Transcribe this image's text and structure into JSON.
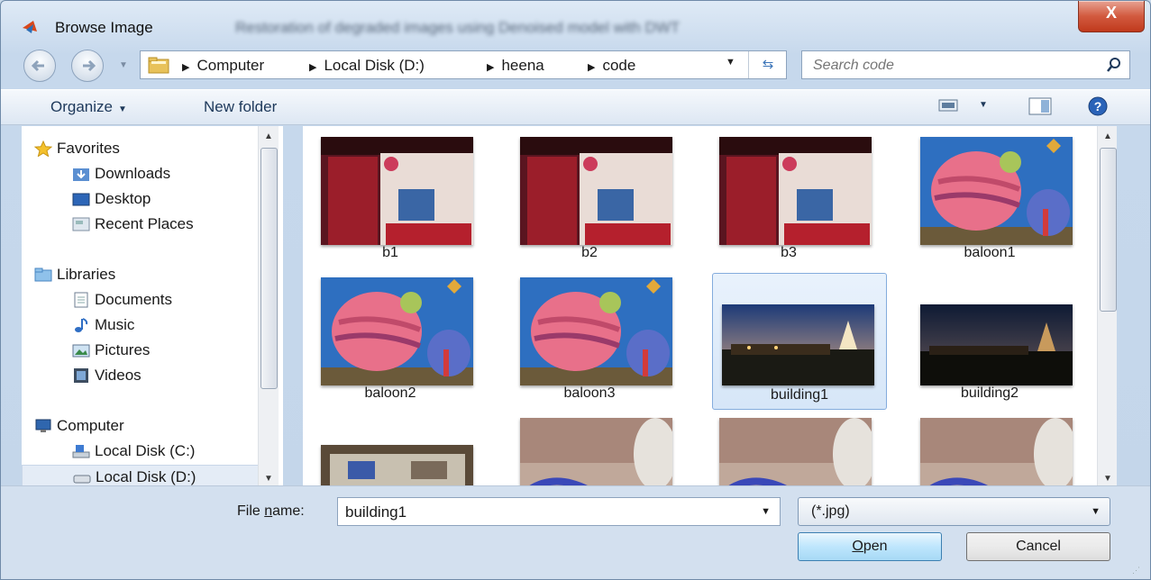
{
  "window": {
    "title": "Browse Image",
    "background_title": "Restoration of degraded images using Denoised model with DWT",
    "close_label": "X"
  },
  "address": {
    "crumbs": [
      "Computer",
      "Local Disk (D:)",
      "heena",
      "code"
    ]
  },
  "search": {
    "placeholder": "Search code"
  },
  "toolbar": {
    "organize_label": "Organize",
    "new_folder_label": "New folder"
  },
  "nav": {
    "favorites_label": "Favorites",
    "downloads_label": "Downloads",
    "desktop_label": "Desktop",
    "recent_label": "Recent Places",
    "libraries_label": "Libraries",
    "documents_label": "Documents",
    "music_label": "Music",
    "pictures_label": "Pictures",
    "videos_label": "Videos",
    "computer_label": "Computer",
    "disk_c_label": "Local Disk (C:)",
    "disk_d_label": "Local Disk (D:)"
  },
  "files": [
    "b1",
    "b2",
    "b3",
    "baloon1",
    "baloon2",
    "baloon3",
    "building1",
    "building2",
    "",
    "",
    "",
    ""
  ],
  "selected_file": "building1",
  "bottom": {
    "file_name_label_pre": "File ",
    "file_name_label_u": "n",
    "file_name_label_post": "ame:",
    "file_name_value": "building1",
    "file_type_value": "(*.jpg)",
    "open_label_u": "O",
    "open_label_rest": "pen",
    "cancel_label": "Cancel"
  },
  "colors": {
    "selection": "#d6e6f8",
    "accent": "#3b74b8",
    "close": "#c0391c"
  }
}
